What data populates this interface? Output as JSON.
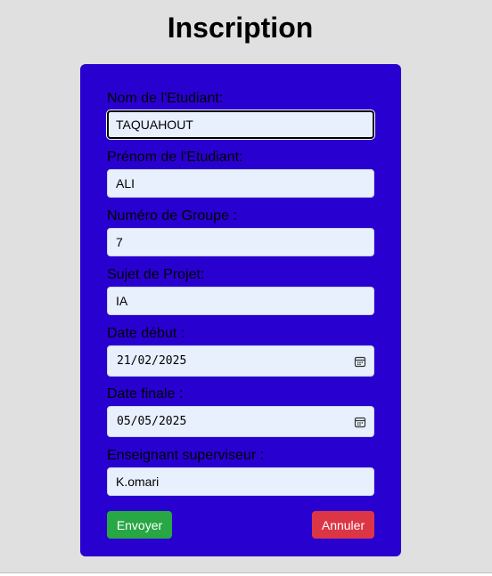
{
  "page": {
    "title": "Inscription"
  },
  "form": {
    "fields": [
      {
        "label": "Nom de l'Etudiant:",
        "value": "TAQUAHOUT"
      },
      {
        "label": "Prénom de l'Etudiant:",
        "value": "ALI"
      },
      {
        "label": "Numéro de Groupe :",
        "value": "7"
      },
      {
        "label": "Sujet de Projet:",
        "value": "IA"
      },
      {
        "label": "Date début :",
        "value": "21/02/2025"
      },
      {
        "label": "Date finale :",
        "value": "05/05/2025"
      },
      {
        "label": "Enseignant superviseur :",
        "value": "K.omari"
      }
    ],
    "submit_label": "Envoyer",
    "cancel_label": "Annuler"
  },
  "icons": {
    "date_picker": "calendar-icon"
  },
  "colors": {
    "background": "#e0e0e0",
    "card": "#2800d0",
    "input": "#e8f0fe",
    "submit": "#28a745",
    "cancel": "#dc3545"
  }
}
